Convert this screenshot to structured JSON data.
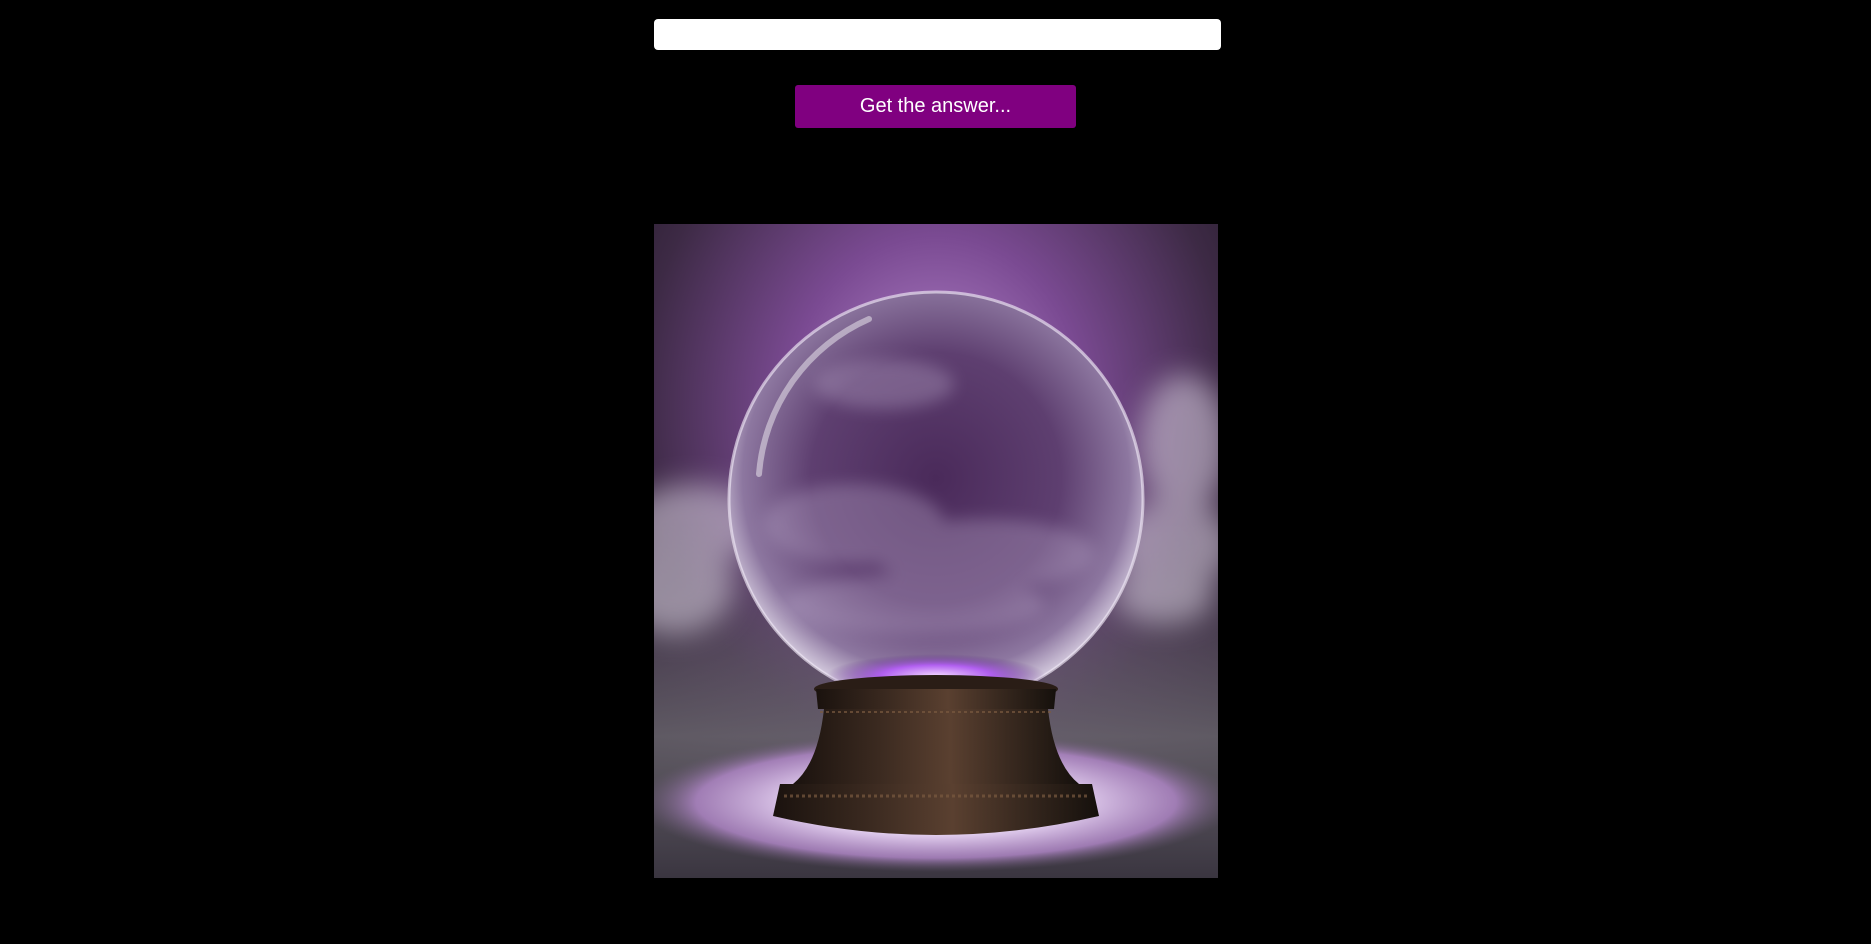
{
  "question": {
    "value": "",
    "placeholder": ""
  },
  "answer_button": {
    "label": "Get the answer..."
  },
  "answer": {
    "text": ""
  },
  "image": {
    "subject": "crystal-ball-image"
  },
  "colors": {
    "background": "#000000",
    "button": "#800080",
    "button_text": "#ffffff",
    "input": "#ffffff"
  }
}
